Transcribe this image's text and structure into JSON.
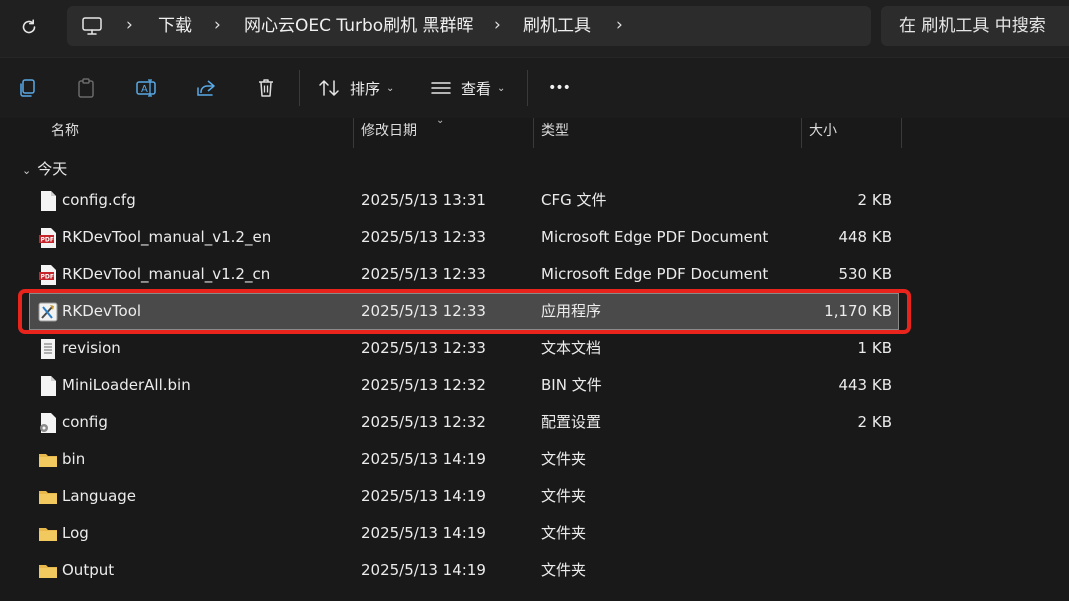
{
  "address": {
    "crumbs": [
      "下载",
      "网心云OEC Turbo刷机 黑群晖",
      "刷机工具"
    ],
    "search_placeholder": "在 刷机工具 中搜索"
  },
  "toolbar": {
    "sort_label": "排序",
    "view_label": "查看",
    "more_label": "•••"
  },
  "columns": {
    "name": "名称",
    "date": "修改日期",
    "type": "类型",
    "size": "大小"
  },
  "group": {
    "label": "今天"
  },
  "files": [
    {
      "name": "config.cfg",
      "date": "2025/5/13 13:31",
      "type": "CFG 文件",
      "size": "2 KB",
      "icon": "file-icon"
    },
    {
      "name": "RKDevTool_manual_v1.2_en",
      "date": "2025/5/13 12:33",
      "type": "Microsoft Edge PDF Document",
      "size": "448 KB",
      "icon": "pdf-icon"
    },
    {
      "name": "RKDevTool_manual_v1.2_cn",
      "date": "2025/5/13 12:33",
      "type": "Microsoft Edge PDF Document",
      "size": "530 KB",
      "icon": "pdf-icon"
    },
    {
      "name": "RKDevTool",
      "date": "2025/5/13 12:33",
      "type": "应用程序",
      "size": "1,170 KB",
      "icon": "app-icon",
      "selected": true
    },
    {
      "name": "revision",
      "date": "2025/5/13 12:33",
      "type": "文本文档",
      "size": "1 KB",
      "icon": "text-file-icon"
    },
    {
      "name": "MiniLoaderAll.bin",
      "date": "2025/5/13 12:32",
      "type": "BIN 文件",
      "size": "443 KB",
      "icon": "file-icon"
    },
    {
      "name": "config",
      "date": "2025/5/13 12:32",
      "type": "配置设置",
      "size": "2 KB",
      "icon": "settings-file-icon"
    },
    {
      "name": "bin",
      "date": "2025/5/13 14:19",
      "type": "文件夹",
      "size": "",
      "icon": "folder-icon"
    },
    {
      "name": "Language",
      "date": "2025/5/13 14:19",
      "type": "文件夹",
      "size": "",
      "icon": "folder-icon"
    },
    {
      "name": "Log",
      "date": "2025/5/13 14:19",
      "type": "文件夹",
      "size": "",
      "icon": "folder-icon"
    },
    {
      "name": "Output",
      "date": "2025/5/13 14:19",
      "type": "文件夹",
      "size": "",
      "icon": "folder-icon"
    }
  ],
  "colors": {
    "highlight": "#e8241c",
    "selected_row": "#4a4a4a",
    "folder": "#e8b84a",
    "pdf": "#c4242a"
  }
}
